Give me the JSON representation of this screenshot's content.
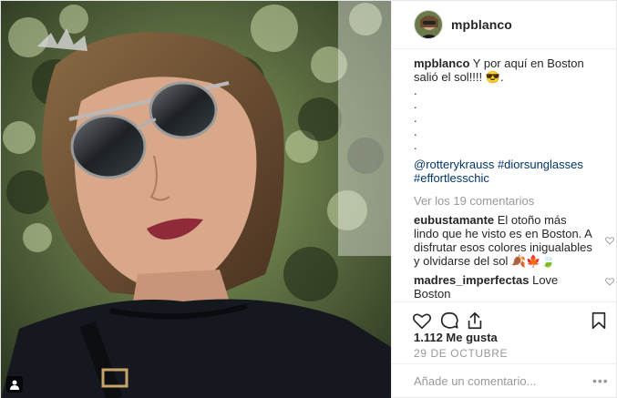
{
  "post": {
    "username": "mpblanco",
    "caption": "Y por aquí en Boston salió el sol!!!! 😎.",
    "caption_dots": [
      ".",
      ".",
      ".",
      ".",
      "."
    ],
    "hashtags": "@rotterykrauss #diorsunglasses #effortlesschic",
    "view_all": "Ver los 19 comentarios",
    "comments": [
      {
        "user": "eubustamante",
        "text": "El otoño más lindo que he visto es en Boston. A disfrutar esos colores inigualables y olvidarse del sol 🍂🍁🍃"
      },
      {
        "user": "madres_imperfectas",
        "text": "Love Boston"
      }
    ],
    "likes": "1.112 Me gusta",
    "date": "29 DE OCTUBRE",
    "add_comment_placeholder": "Añade un comentario...",
    "more": "•••"
  },
  "icons": {
    "like": "heart-icon",
    "comment": "comment-bubble-icon",
    "share": "share-icon",
    "save": "bookmark-icon",
    "tag": "user-tag-icon"
  },
  "colors": {
    "hashtag": "#003569",
    "muted": "#999999",
    "text": "#262626"
  }
}
